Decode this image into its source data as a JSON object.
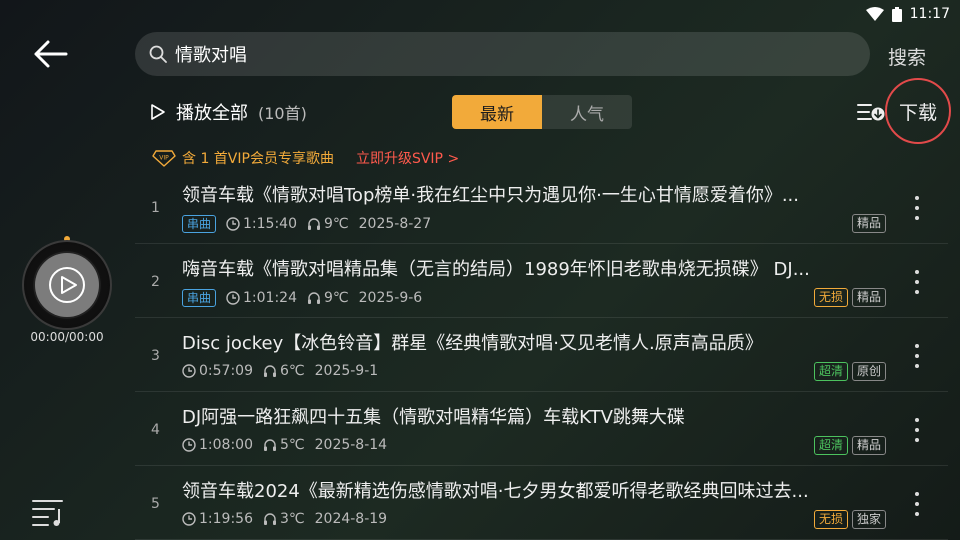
{
  "status": {
    "time": "11:17"
  },
  "search": {
    "query": "情歌对唱",
    "button": "搜索"
  },
  "toolbar": {
    "play_all": "播放全部",
    "count": "(10首)",
    "tabs": [
      {
        "label": "最新",
        "active": true
      },
      {
        "label": "人气",
        "active": false
      }
    ],
    "download": "下载"
  },
  "vip": {
    "text": "含 1 首VIP会员专享歌曲",
    "upgrade": "立即升级SVIP >"
  },
  "songs": [
    {
      "index": "1",
      "title": "领音车载《情歌对唱Top榜单·我在红尘中只为遇见你·一生心甘情愿爱着你》...",
      "series": "串曲",
      "duration": "1:15:40",
      "temp": "9℃",
      "date": "2025-8-27",
      "badges": [
        {
          "text": "精品",
          "style": "gray"
        }
      ]
    },
    {
      "index": "2",
      "title": "嗨音车载《情歌对唱精品集（无言的结局）1989年怀旧老歌串烧无损碟》 DJ...",
      "series": "串曲",
      "duration": "1:01:24",
      "temp": "9℃",
      "date": "2025-9-6",
      "badges": [
        {
          "text": "无损",
          "style": "gold"
        },
        {
          "text": "精品",
          "style": "gray"
        }
      ]
    },
    {
      "index": "3",
      "title": "Disc jockey【冰色铃音】群星《经典情歌对唱·又见老情人.原声高品质》",
      "series": "",
      "duration": "0:57:09",
      "temp": "6℃",
      "date": "2025-9-1",
      "badges": [
        {
          "text": "超清",
          "style": "green"
        },
        {
          "text": "原创",
          "style": "gray"
        }
      ]
    },
    {
      "index": "4",
      "title": "DJ阿强一路狂飙四十五集（情歌对唱精华篇）车载KTV跳舞大碟",
      "series": "",
      "duration": "1:08:00",
      "temp": "5℃",
      "date": "2025-8-14",
      "badges": [
        {
          "text": "超清",
          "style": "green"
        },
        {
          "text": "精品",
          "style": "gray"
        }
      ]
    },
    {
      "index": "5",
      "title": "领音车载2024《最新精选伤感情歌对唱·七夕男女都爱听得老歌经典回味过去...",
      "series": "",
      "duration": "1:19:56",
      "temp": "3℃",
      "date": "2024-8-19",
      "badges": [
        {
          "text": "无损",
          "style": "gold"
        },
        {
          "text": "独家",
          "style": "gray"
        }
      ]
    }
  ],
  "player": {
    "time": "00:00/00:00"
  },
  "colors": {
    "accent": "#f2aa3a",
    "highlight_circle": "#e24a4a",
    "vip_upgrade": "#ff5a4d",
    "series_tag": "#4aa3e0",
    "hd_badge": "#4cc25e"
  }
}
